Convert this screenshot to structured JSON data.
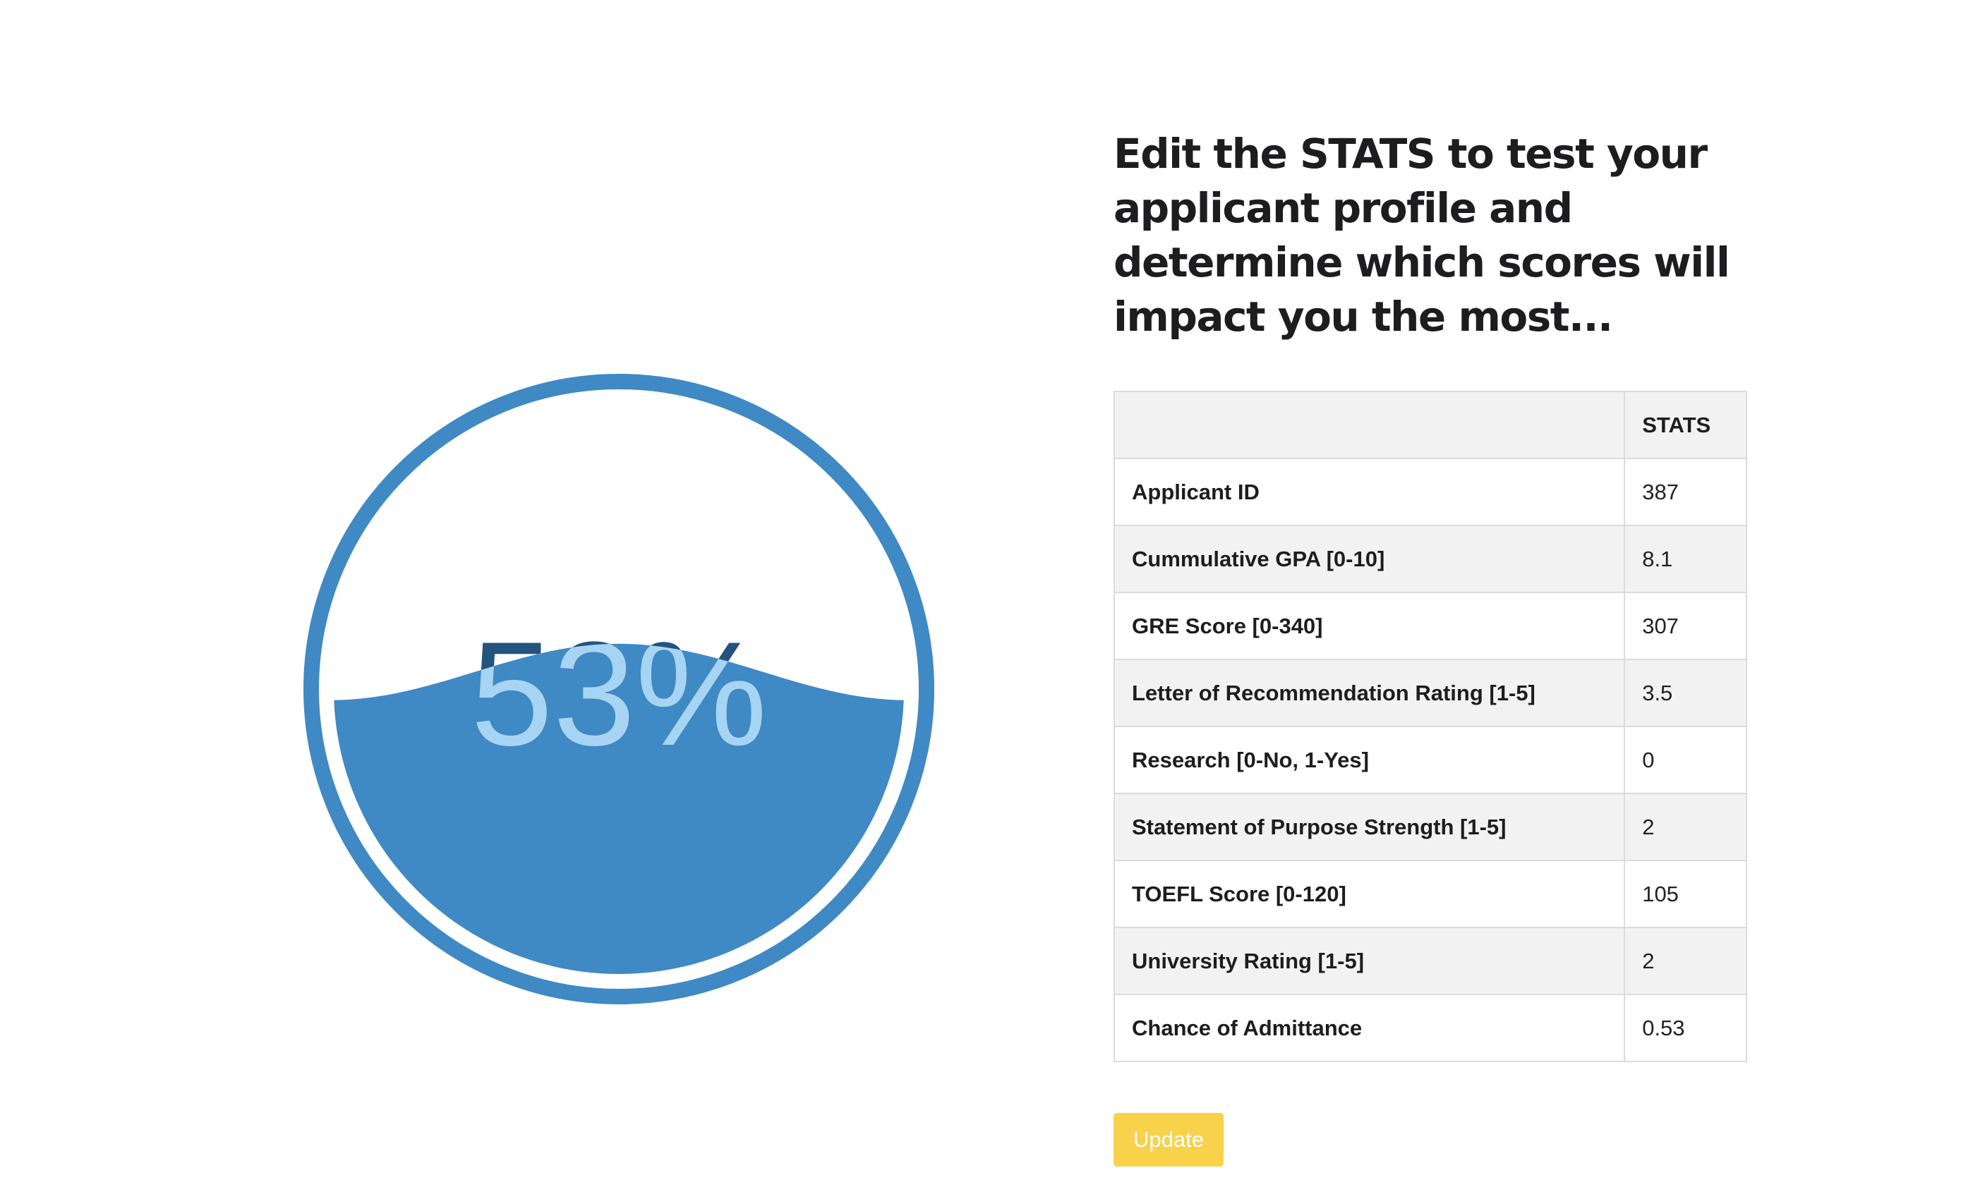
{
  "gauge": {
    "percent_label": "53%",
    "fill_fraction": 0.53,
    "colors": {
      "ring": "#3f89c4",
      "fill": "#3f89c4",
      "text_above_fill": "#23537f",
      "text_in_fill": "#a8d4f4"
    }
  },
  "headline": "Edit the STATS to test your applicant profile and determine which scores will impact you the most...",
  "table": {
    "header": {
      "label": "",
      "value": "STATS"
    },
    "rows": [
      {
        "label": "Applicant ID",
        "value": "387"
      },
      {
        "label": "Cummulative GPA [0-10]",
        "value": "8.1"
      },
      {
        "label": "GRE Score [0-340]",
        "value": "307"
      },
      {
        "label": "Letter of Recommendation Rating [1-5]",
        "value": "3.5"
      },
      {
        "label": "Research [0-No, 1-Yes]",
        "value": "0"
      },
      {
        "label": "Statement of Purpose Strength [1-5]",
        "value": "2"
      },
      {
        "label": "TOEFL Score [0-120]",
        "value": "105"
      },
      {
        "label": "University Rating [1-5]",
        "value": "2"
      },
      {
        "label": "Chance of Admittance",
        "value": "0.53"
      }
    ]
  },
  "update_button": {
    "label": "Update",
    "color": "#f7d24a"
  }
}
